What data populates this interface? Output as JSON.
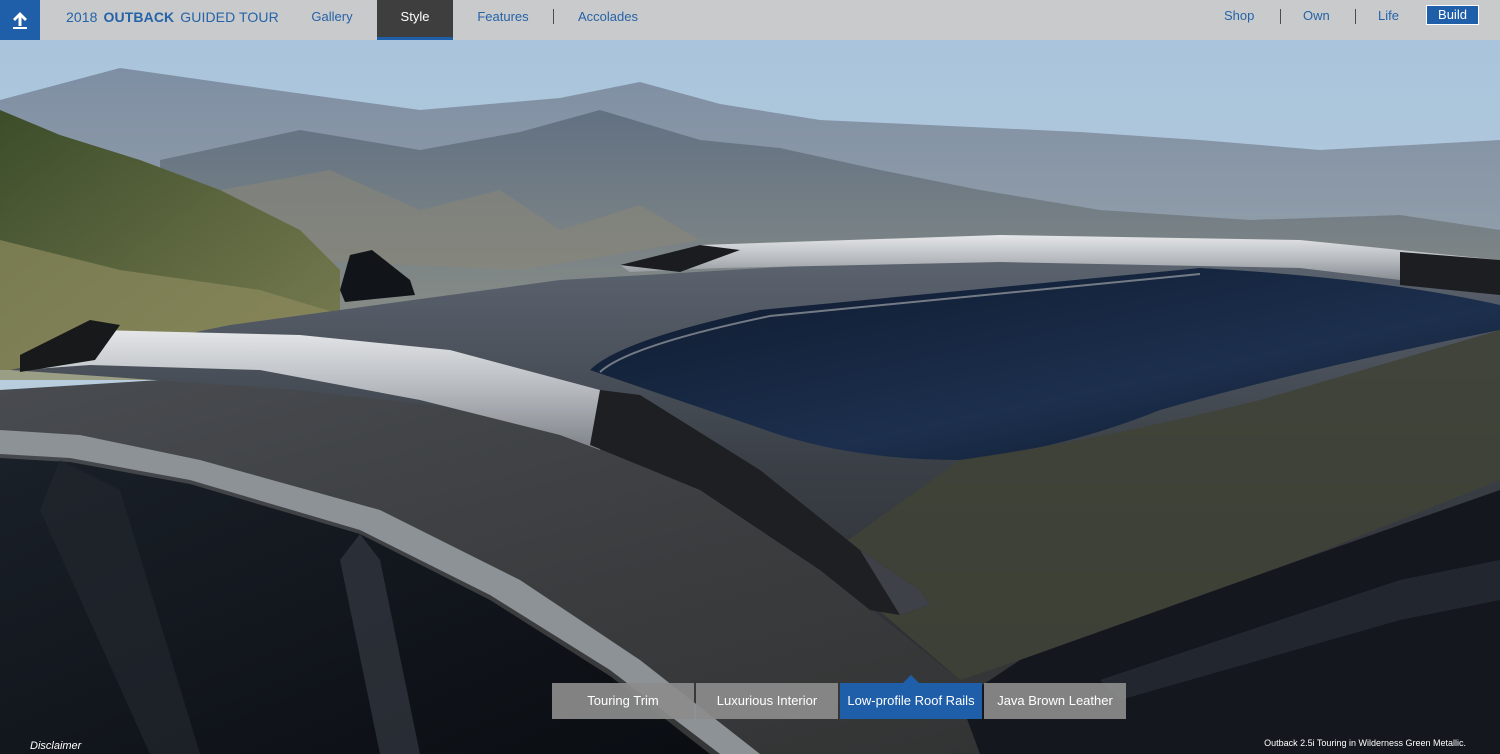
{
  "header": {
    "back_icon": "upload-arrow-icon",
    "title_year": "2018",
    "title_model": "OUTBACK",
    "title_suffix": "GUIDED TOUR",
    "tabs": [
      {
        "label": "Gallery",
        "active": false
      },
      {
        "label": "Style",
        "active": true
      },
      {
        "label": "Features",
        "active": false
      },
      {
        "label": "Accolades",
        "active": false
      }
    ],
    "links": [
      {
        "label": "Shop"
      },
      {
        "label": "Own"
      },
      {
        "label": "Life"
      }
    ],
    "build_label": "Build"
  },
  "feature_tabs": [
    {
      "label": "Touring Trim",
      "active": false
    },
    {
      "label": "Luxurious Interior",
      "active": false
    },
    {
      "label": "Low-profile Roof Rails",
      "active": true
    },
    {
      "label": "Java Brown Leather",
      "active": false
    }
  ],
  "footer": {
    "disclaimer": "Disclaimer",
    "caption": "Outback 2.5i Touring in Wilderness Green Metallic."
  },
  "colors": {
    "brand_blue": "#1f5ea8",
    "topbar_gray": "#c9cacb",
    "active_tab": "#3e3e3e"
  }
}
